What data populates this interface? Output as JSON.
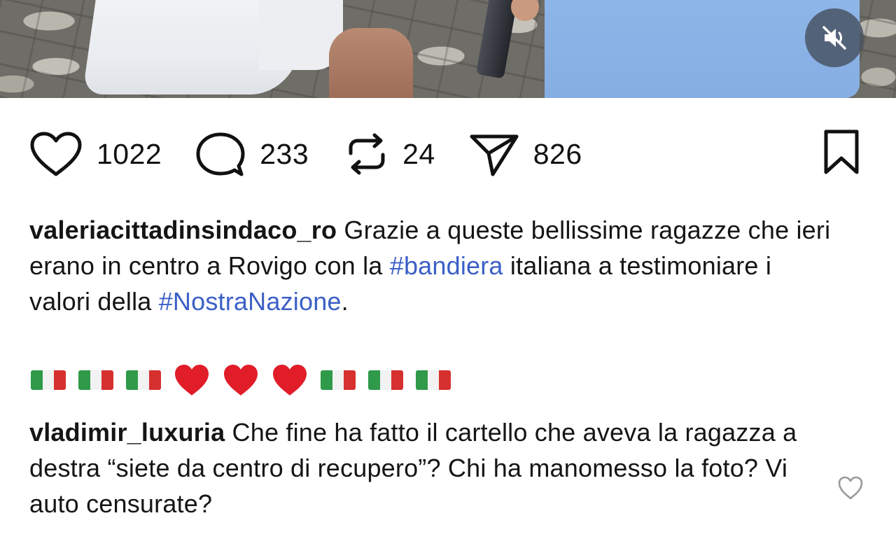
{
  "media": {
    "mute_icon": "speaker-muted-icon"
  },
  "actions": {
    "like": {
      "icon": "heart-outline-icon",
      "count": "1022"
    },
    "comment": {
      "icon": "comment-bubble-icon",
      "count": "233"
    },
    "repost": {
      "icon": "repost-arrows-icon",
      "count": "24"
    },
    "share": {
      "icon": "paper-plane-icon",
      "count": "826"
    },
    "save": {
      "icon": "bookmark-icon"
    }
  },
  "caption": {
    "username": "valeriacittadinsindaco_ro",
    "text_1": " Grazie a queste bellissime ragazze che ieri erano in centro a Rovigo con la ",
    "hashtag_1": "#bandiera",
    "text_2": "  italiana a testimoniare i valori della ",
    "hashtag_2": "#NostraNazione",
    "text_3": ".",
    "emojis": [
      "🇮🇹",
      "🇮🇹",
      "🇮🇹",
      "❤️",
      "❤️",
      "❤️",
      "🇮🇹",
      "🇮🇹",
      "🇮🇹"
    ]
  },
  "comments": [
    {
      "username": "vladimir_luxuria",
      "text": " Che fine ha fatto il cartello che aveva la ragazza a destra “siete da centro di recupero”? Chi ha manomesso la foto? Vi auto censurate?",
      "like_icon": "heart-outline-small-icon"
    }
  ],
  "colors": {
    "hashtag": "#3b5fc6",
    "text": "#151515",
    "dress_right": "#8fb6e8"
  }
}
